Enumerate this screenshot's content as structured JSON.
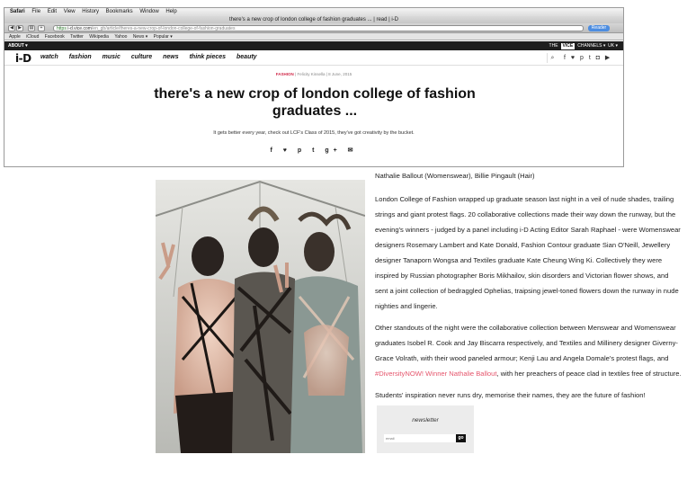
{
  "browser": {
    "menubar": [
      "Safari",
      "File",
      "Edit",
      "View",
      "History",
      "Bookmarks",
      "Window",
      "Help"
    ],
    "tab_title": "there's a new crop of london college of fashion graduates ... | read | i-D",
    "url_proto": "https",
    "url_host": "i-d.vice.com",
    "url_path": "/en_gb/article/theres-a-new-crop-of-london-college-of-fashion-graduates",
    "reader_label": "Reader",
    "bookmarks": [
      "Apple",
      "iCloud",
      "Facebook",
      "Twitter",
      "Wikipedia",
      "Yahoo",
      "News ▾",
      "Popular ▾"
    ]
  },
  "vicebar": {
    "about": "ABOUT ▾",
    "the": "THE",
    "logo": "VICE",
    "channels": "CHANNELS ▾",
    "region": "UK ▾"
  },
  "nav": {
    "logo": "i-D",
    "links": [
      "watch",
      "fashion",
      "music",
      "culture",
      "news",
      "think pieces",
      "beauty"
    ],
    "search_icon": "search-icon",
    "social": "f ♥ p t ◘ ▶"
  },
  "article": {
    "tag": "FASHION",
    "byline": "| Felicity Kinsella | 8 June, 2015",
    "title": "there's a new crop of london college of fashion graduates ...",
    "dek": "It gets better every year, check out LCF's Class of 2015, they've got creativity by the bucket.",
    "share": "f ♥ p t g+ ✉",
    "credit": "Nathalie Ballout (Womenswear), Billie Pingault (Hair)",
    "p1": "London College of Fashion wrapped up graduate season last night in a veil of nude shades, trailing strings and giant protest flags. 20 collaborative collections made their way down the runway, but the evening's winners - judged by a panel including i-D Acting Editor Sarah Raphael - were Womenswear designers Rosemary Lambert and Kate Donald, Fashion Contour graduate Sian O'Neill, Jewellery designer Tanaporn Wongsa and Textiles graduate Kate Cheung Wing Ki. Collectively they were inspired by Russian photographer Boris Mikhailov, skin disorders and Victorian flower shows, and sent a joint collection of bedraggled Ophelias, traipsing jewel-toned flowers down the runway in nude nighties and lingerie.",
    "p2_a": "Other standouts of the night were the collaborative collection between Menswear and Womenswear graduates Isobel R. Cook and Jay Biscarra respectively, and Textiles and Millinery designer Giverny-Grace Volrath, with their wood paneled armour; Kenji Lau and Angela Domale's protest flags, and ",
    "p2_link": "#DiversityNOW! Winner Nathalie Ballout",
    "p2_b": ", with her preachers of peace clad in textiles free of structure.",
    "p3": "Students' inspiration never runs dry, memorise their names, they are the future of fashion!"
  },
  "newsletter": {
    "title": "newsletter",
    "placeholder": "email",
    "go": "go"
  },
  "colors": {
    "accent_pink": "#e5556c",
    "vice_bar": "#1e1e1e"
  }
}
